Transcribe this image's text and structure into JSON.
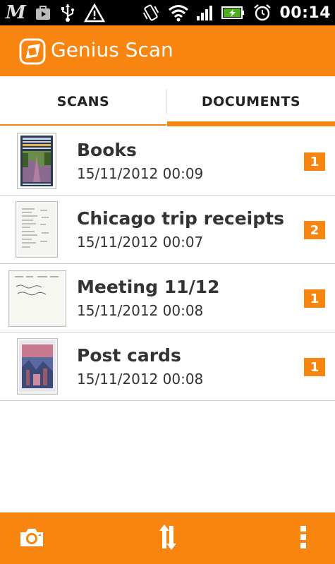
{
  "status_bar": {
    "time": "00:14",
    "left_icons": [
      "m-app-icon",
      "play-store-icon",
      "usb-icon",
      "warning-icon"
    ],
    "right_icons": [
      "vibrate-icon",
      "wifi-icon",
      "signal-icon",
      "battery-charging-icon",
      "alarm-icon"
    ]
  },
  "app_bar": {
    "title": "Genius Scan",
    "logo": "genius-scan-logo-icon",
    "color": "#f7850f"
  },
  "tabs": [
    {
      "label": "SCANS",
      "selected": false
    },
    {
      "label": "DOCUMENTS",
      "selected": true
    }
  ],
  "documents": [
    {
      "name": "Books",
      "date": "15/11/2012 00:09",
      "count": "1",
      "thumbnail": "book-cover"
    },
    {
      "name": "Chicago trip receipts",
      "date": "15/11/2012 00:07",
      "count": "2",
      "thumbnail": "receipt"
    },
    {
      "name": "Meeting 11/12",
      "date": "15/11/2012 00:08",
      "count": "1",
      "thumbnail": "handwritten-note"
    },
    {
      "name": "Post cards",
      "date": "15/11/2012 00:08",
      "count": "1",
      "thumbnail": "postcard"
    }
  ],
  "bottom_bar": {
    "camera": "camera-icon",
    "sort": "sort-icon",
    "overflow": "overflow-menu-icon"
  },
  "colors": {
    "accent": "#f7850f",
    "text": "#333333",
    "divider": "#cfcfcf"
  }
}
